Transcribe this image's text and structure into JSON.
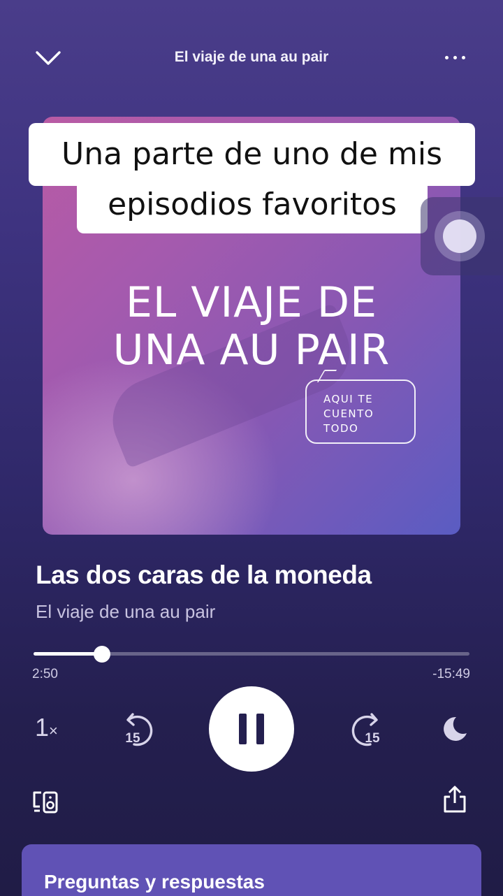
{
  "header": {
    "title": "El viaje de una au pair",
    "collapse_icon": "chevron-down-icon",
    "more_icon": "more-horizontal-icon"
  },
  "overlay_caption": {
    "line1": "Una parte de uno de mis",
    "line2": "episodios favoritos"
  },
  "artwork": {
    "title_line1": "EL VIAJE DE",
    "title_line2": "UNA AU PAIR",
    "bubble_lines": [
      "AQUI TE",
      "CUENTO",
      "TODO"
    ]
  },
  "episode": {
    "title": "Las dos caras de la moneda",
    "show": "El viaje de una au pair"
  },
  "playback": {
    "elapsed": "2:50",
    "remaining": "-15:49",
    "progress_fraction": 0.157,
    "speed_value": "1",
    "speed_suffix": "×",
    "rewind_seconds": "15",
    "forward_seconds": "15",
    "state": "playing"
  },
  "icons": {
    "rewind": "rewind-15-icon",
    "forward": "forward-15-icon",
    "play_pause": "pause-icon",
    "sleep_timer": "moon-icon",
    "connect_device": "connect-device-icon",
    "share": "share-icon"
  },
  "card": {
    "title": "Preguntas y respuestas"
  },
  "colors": {
    "accent_card": "#6052b5",
    "background_top": "#4a3d8a",
    "background_bottom": "#201c46"
  }
}
